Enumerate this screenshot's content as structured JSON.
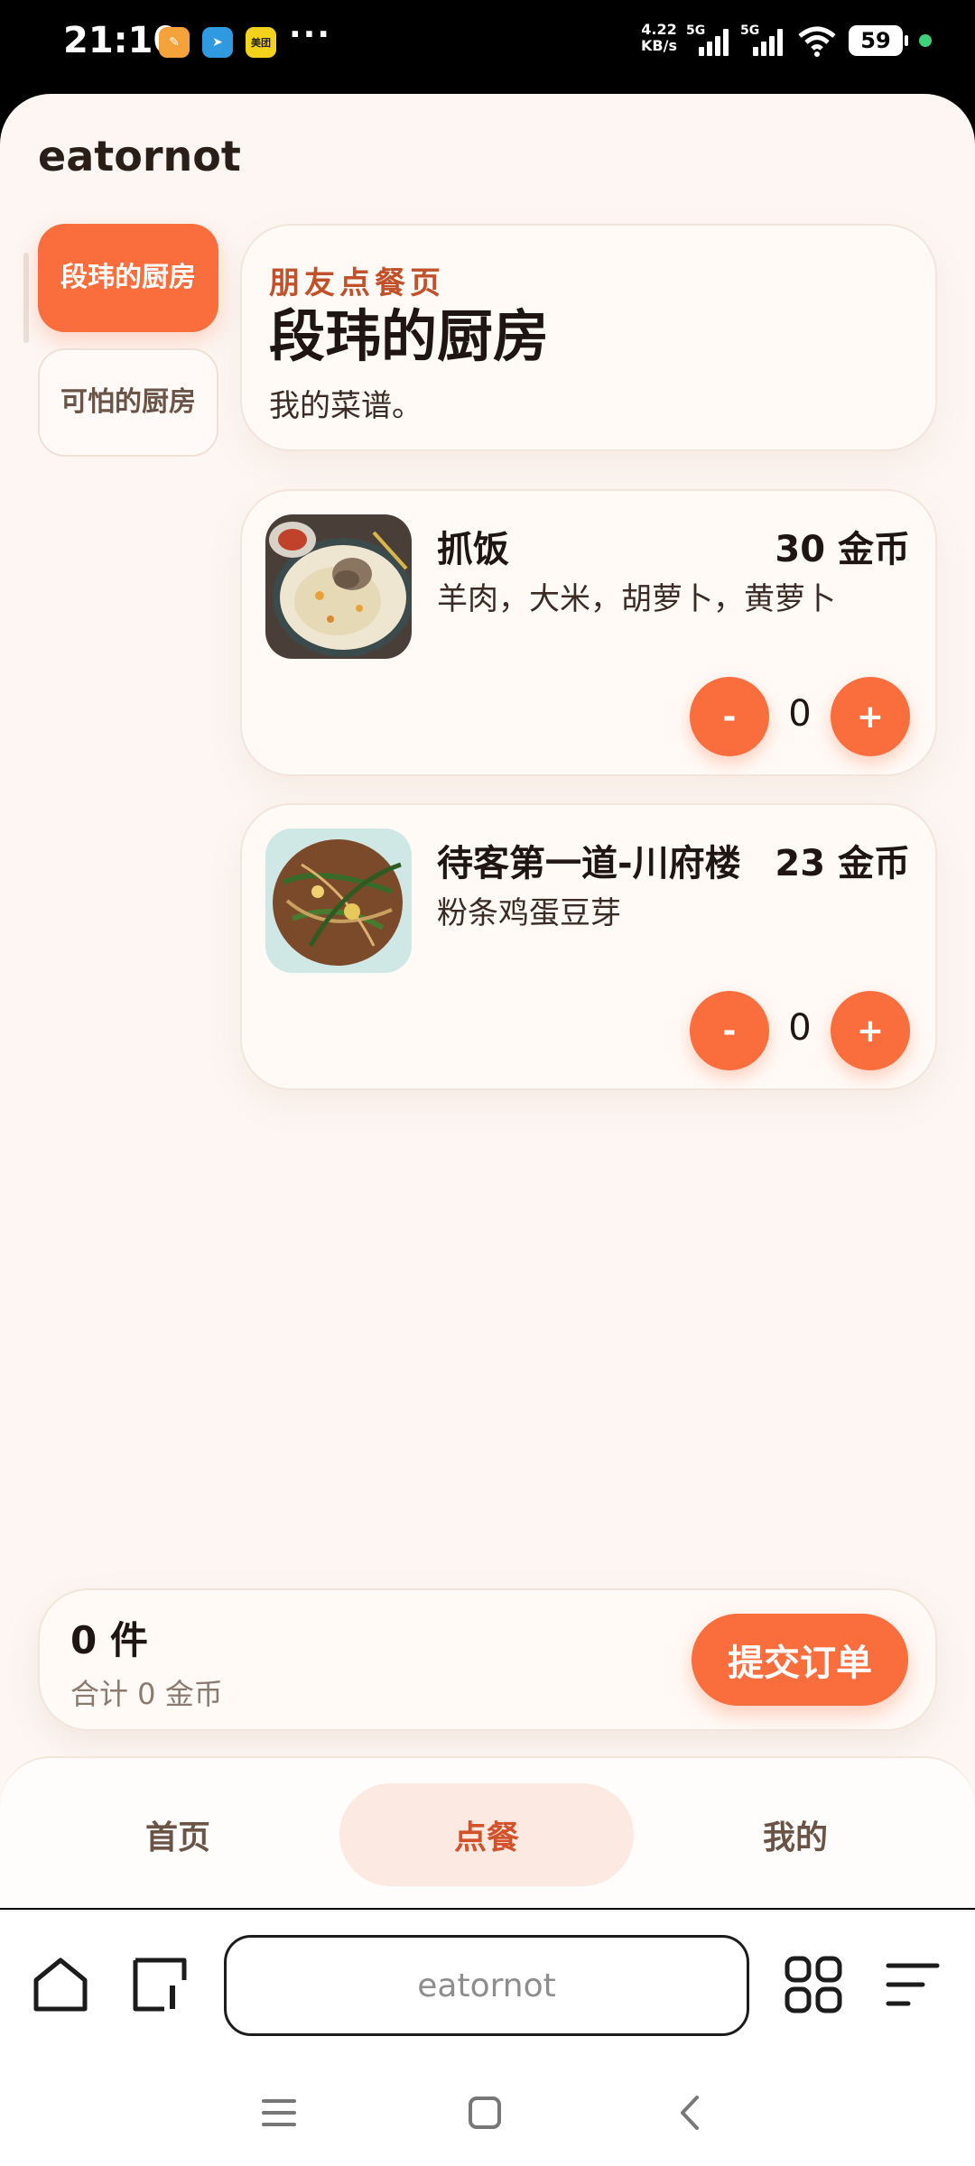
{
  "status": {
    "time": "21:10",
    "app_icons": [
      {
        "name": "orange-app",
        "glyph": "✎"
      },
      {
        "name": "send-app",
        "glyph": "➤"
      },
      {
        "name": "meituan-app",
        "glyph": "美团"
      }
    ],
    "more": "···",
    "speed_value": "4.22",
    "speed_unit": "KB/s",
    "signal1_label": "5G",
    "signal2_label": "5G",
    "battery": "59"
  },
  "app": {
    "title": "eatornot"
  },
  "kitchens": [
    {
      "label": "段玮的厨房",
      "active": true
    },
    {
      "label": "可怕的厨房",
      "active": false
    }
  ],
  "hero": {
    "subtitle": "朋友点餐页",
    "title": "段玮的厨房",
    "description": "我的菜谱。"
  },
  "dishes": [
    {
      "name": "抓饭",
      "price": "30 金币",
      "ingredients": "羊肉，大米，胡萝卜，黄萝卜",
      "quantity": "0",
      "minus_label": "-",
      "plus_label": "+",
      "image": "pilaf-photo"
    },
    {
      "name": "待客第一道-川府楼",
      "price": "23 金币",
      "ingredients": "粉条鸡蛋豆芽",
      "quantity": "0",
      "minus_label": "-",
      "plus_label": "+",
      "image": "stirfry-photo"
    }
  ],
  "cart": {
    "count": "0 件",
    "total": "合计 0 金币",
    "submit_label": "提交订单"
  },
  "tabs": [
    {
      "label": "首页"
    },
    {
      "label": "点餐"
    },
    {
      "label": "我的"
    }
  ],
  "browser": {
    "url": "eatornot",
    "icons": [
      "home-icon",
      "tabs-icon",
      "apps-grid-icon",
      "menu-icon"
    ]
  },
  "system_nav": {
    "icons": [
      "recent-apps-icon",
      "home-square-icon",
      "back-icon"
    ]
  },
  "colors": {
    "accent": "#fa6e3e",
    "accent_dark": "#c0512a",
    "background": "#fdf6f2"
  }
}
